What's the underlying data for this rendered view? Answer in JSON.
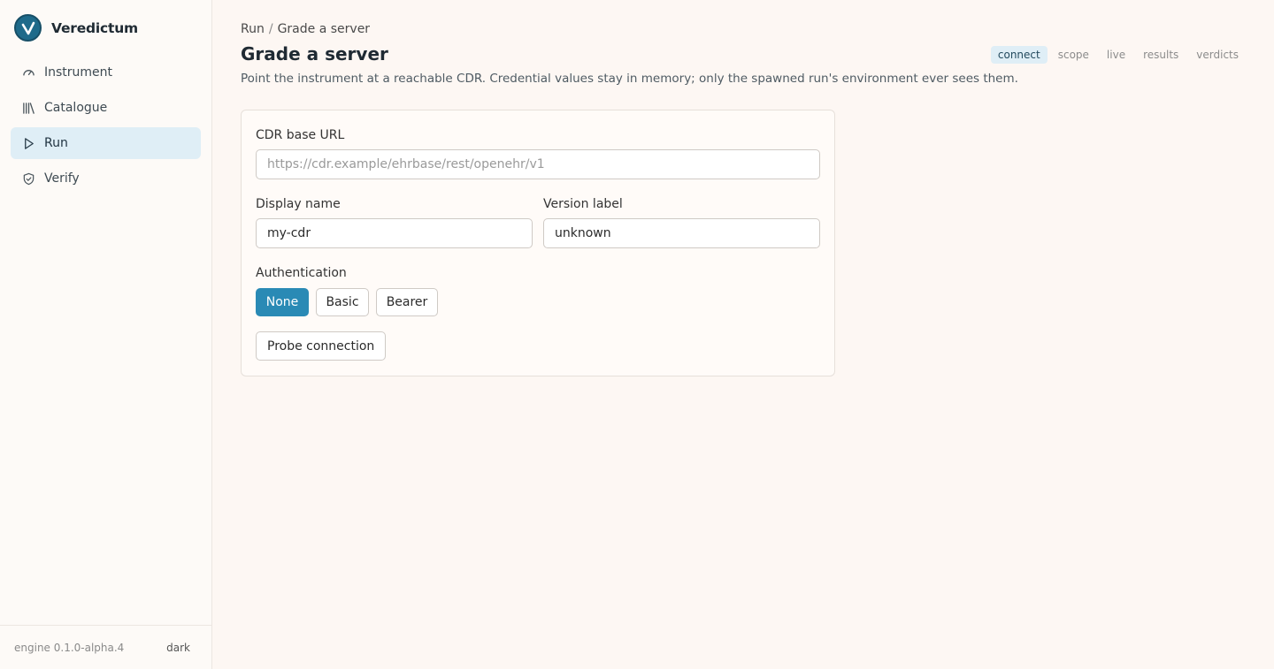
{
  "app": {
    "name": "Veredictum"
  },
  "sidebar": {
    "items": [
      {
        "label": "Instrument",
        "icon": "gauge-icon"
      },
      {
        "label": "Catalogue",
        "icon": "library-icon"
      },
      {
        "label": "Run",
        "icon": "play-icon",
        "active": true
      },
      {
        "label": "Verify",
        "icon": "shield-check-icon"
      }
    ],
    "footer": {
      "engine": "engine 0.1.0-alpha.4",
      "theme_toggle": "dark"
    }
  },
  "breadcrumb": {
    "parent": "Run",
    "separator": "/",
    "current": "Grade a server"
  },
  "page": {
    "title": "Grade a server",
    "subtitle": "Point the instrument at a reachable CDR. Credential values stay in memory; only the spawned run's environment ever sees them."
  },
  "steps": [
    {
      "label": "connect",
      "active": true
    },
    {
      "label": "scope"
    },
    {
      "label": "live"
    },
    {
      "label": "results"
    },
    {
      "label": "verdicts"
    }
  ],
  "form": {
    "cdr_url": {
      "label": "CDR base URL",
      "placeholder": "https://cdr.example/ehrbase/rest/openehr/v1",
      "value": ""
    },
    "display_name": {
      "label": "Display name",
      "value": "my-cdr"
    },
    "version_label": {
      "label": "Version label",
      "value": "unknown"
    },
    "auth": {
      "label": "Authentication",
      "options": [
        "None",
        "Basic",
        "Bearer"
      ],
      "selected": "None"
    },
    "probe_label": "Probe connection"
  },
  "colors": {
    "accent": "#2a8ab5",
    "brand": "#1e6a8a",
    "active_nav": "#dfeef6"
  }
}
